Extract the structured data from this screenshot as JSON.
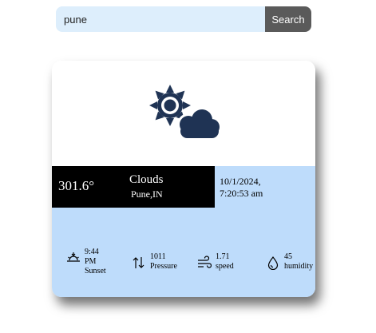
{
  "search": {
    "value": "pune",
    "button_label": "Search"
  },
  "weather": {
    "icon": "sun-behind-cloud-icon",
    "temperature": "301.6°",
    "condition": "Clouds",
    "location": "Pune,IN",
    "date": "10/1/2024,",
    "time": "7:20:53 am"
  },
  "stats": {
    "sunset": {
      "icon": "sunset-icon",
      "value_line1": "9:44",
      "value_line2": "PM",
      "label": "Sunset"
    },
    "pressure": {
      "icon": "pressure-arrows-icon",
      "value": "1011",
      "label": "Pressure"
    },
    "wind": {
      "icon": "wind-icon",
      "value": "1.71",
      "label": "speed"
    },
    "humidity": {
      "icon": "droplet-icon",
      "value": "45",
      "label": "humidity"
    }
  },
  "colors": {
    "search_background": "#ddeefc",
    "search_button": "#5a5a5a",
    "info_band": "#bedcfb",
    "temperature_band": "#000000",
    "icon_fill": "#1f3354"
  }
}
